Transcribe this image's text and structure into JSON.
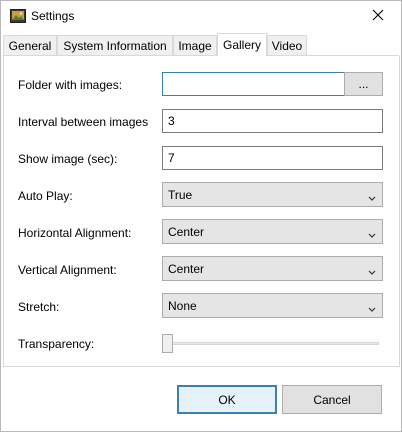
{
  "window": {
    "title": "Settings"
  },
  "tabs": [
    {
      "label": "General"
    },
    {
      "label": "System Information"
    },
    {
      "label": "Image"
    },
    {
      "label": "Gallery",
      "selected": true
    },
    {
      "label": "Video"
    }
  ],
  "gallery": {
    "folder": {
      "label": "Folder with images:",
      "value": "",
      "browse_label": "..."
    },
    "interval": {
      "label": "Interval between images",
      "value": "3"
    },
    "show_time": {
      "label": "Show image (sec):",
      "value": "7"
    },
    "auto_play": {
      "label": "Auto Play:",
      "value": "True"
    },
    "horizontal_alignment": {
      "label": "Horizontal Alignment:",
      "value": "Center"
    },
    "vertical_alignment": {
      "label": "Vertical Alignment:",
      "value": "Center"
    },
    "stretch": {
      "label": "Stretch:",
      "value": "None"
    },
    "transparency": {
      "label": "Transparency:",
      "value": 0
    }
  },
  "footer": {
    "ok_label": "OK",
    "cancel_label": "Cancel"
  },
  "colors": {
    "accent": "#3c7fb1",
    "combo_bg": "#e5e5e5",
    "button_bg": "#e1e1e1"
  },
  "icons": {
    "app": "settings-app-icon",
    "close": "close-icon",
    "dropdown": "chevron-down-icon"
  }
}
